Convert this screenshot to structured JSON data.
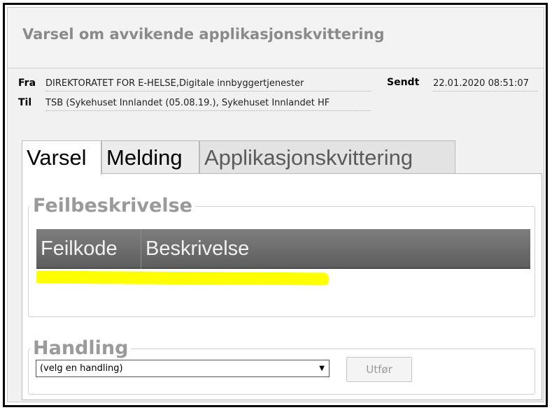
{
  "dialog": {
    "title": "Varsel om avvikende applikasjonskvittering"
  },
  "header": {
    "from_label": "Fra",
    "from_value": "DIREKTORATET FOR E-HELSE,Digitale innbyggertjenester",
    "sent_label": "Sendt",
    "sent_value": "22.01.2020 08:51:07",
    "to_label": "Til",
    "to_value": "TSB (Sykehuset Innlandet (05.08.19.), Sykehuset Innlandet HF"
  },
  "tabs": [
    {
      "label": "Varsel",
      "active": true
    },
    {
      "label": "Melding",
      "active": false
    },
    {
      "label": "Applikasjonskvittering",
      "active": false
    }
  ],
  "error_section": {
    "legend": "Feilbeskrivelse",
    "columns": [
      "Feilkode",
      "Beskrivelse"
    ],
    "rows": []
  },
  "action_section": {
    "legend": "Handling",
    "select_value": "(velg en handling)",
    "execute_label": "Utfør"
  },
  "colors": {
    "highlight": "#ffff00",
    "grid_header": "#6e6e6e"
  }
}
